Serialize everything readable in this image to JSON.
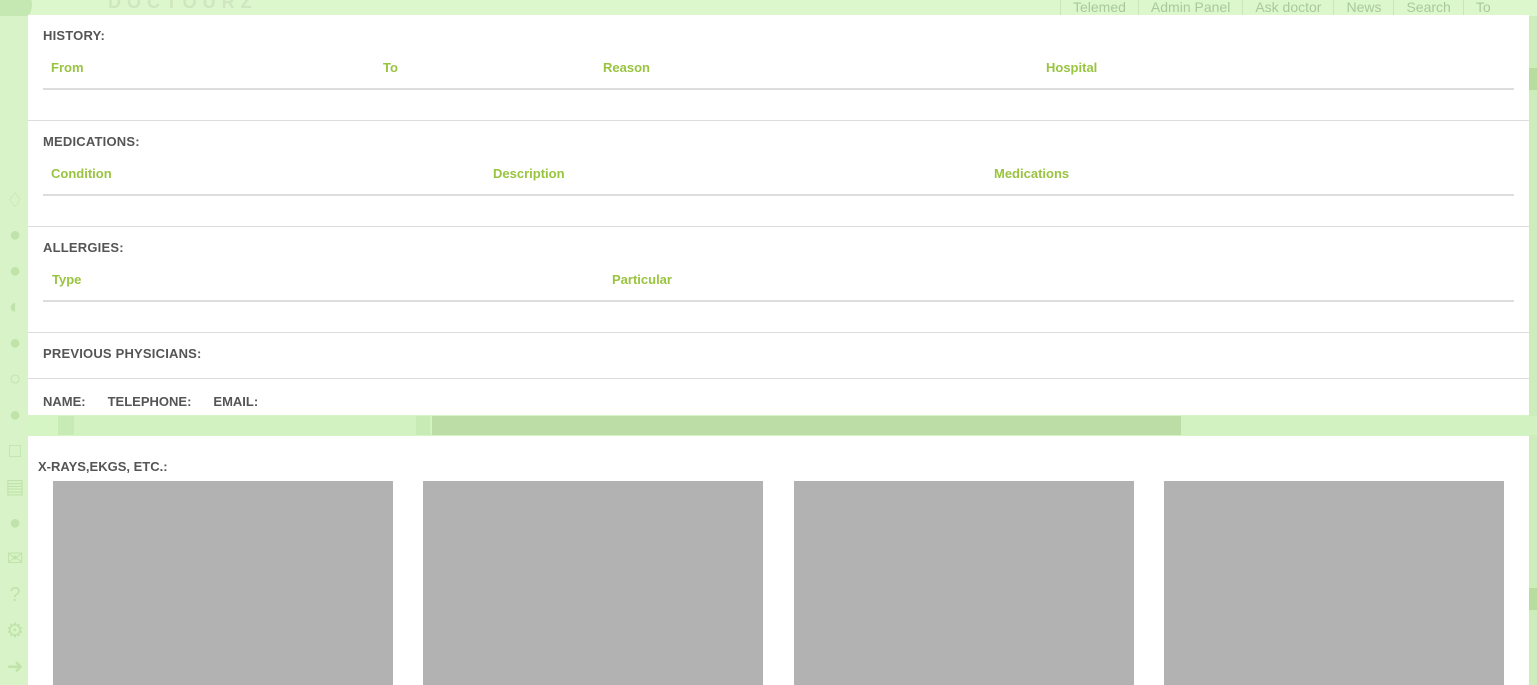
{
  "background": {
    "nav": [
      "Telemed",
      "Admin Panel",
      "Ask doctor",
      "News",
      "Search",
      "To"
    ],
    "logo_text": "DOCTOURZ",
    "sidebar_icons": [
      "bell-icon",
      "user-icon",
      "doctor-icon",
      "contrast-icon",
      "doctor-icon",
      "chat-icon",
      "users-icon",
      "folder-icon",
      "document-icon",
      "add-user-icon",
      "mail-icon",
      "help-icon",
      "gear-icon",
      "arrow-right-icon"
    ]
  },
  "history": {
    "title": "HISTORY:",
    "columns": [
      "From",
      "To",
      "Reason",
      "Hospital"
    ]
  },
  "medications": {
    "title": "MEDICATIONS:",
    "columns": [
      "Condition",
      "Description",
      "Medications"
    ]
  },
  "allergies": {
    "title": "ALLERGIES:",
    "columns": [
      "Type",
      "Particular"
    ]
  },
  "previous_physicians": {
    "title": "PREVIOUS PHYSICIANS:",
    "fields": [
      "NAME:",
      "TELEPHONE:",
      "EMAIL:"
    ]
  },
  "progress": {
    "fraction": 0.5
  },
  "xrays": {
    "title": "X-RAYS,EKGS, ETC.:",
    "thumbnail_count": 4
  },
  "colors": {
    "accent": "#99c440",
    "heading": "#555555",
    "thumbnail": "#b2b2b2",
    "background": "#d6f5c4"
  }
}
